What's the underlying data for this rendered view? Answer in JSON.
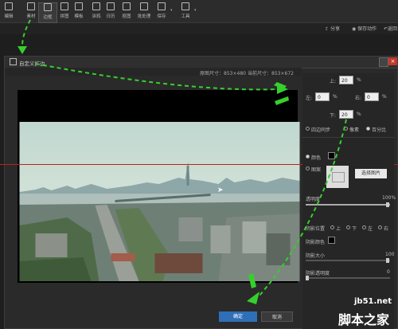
{
  "toolbar": {
    "items": [
      {
        "label": "编辑",
        "icon": "edit-icon"
      },
      {
        "label": "素材",
        "icon": "material-icon"
      },
      {
        "label": "边框",
        "icon": "border-icon"
      },
      {
        "label": "拼图",
        "icon": "collage-icon"
      },
      {
        "label": "模板",
        "icon": "template-icon"
      },
      {
        "label": "涂鸦",
        "icon": "doodle-icon"
      },
      {
        "label": "日历",
        "icon": "calendar-icon"
      },
      {
        "label": "抠图",
        "icon": "cutout-icon"
      },
      {
        "label": "批处理",
        "icon": "batch-icon"
      },
      {
        "label": "保存",
        "icon": "save-icon"
      },
      {
        "label": "工具",
        "icon": "tools-icon"
      }
    ]
  },
  "subbar": {
    "share": "分享",
    "save_action": "保存动作",
    "back": "返回"
  },
  "dialog": {
    "title": "自定义扩边",
    "original_size_label": "原图尺寸：",
    "original_size": "853×480",
    "current_size_label": "当前尺寸：",
    "current_size": "853×672"
  },
  "panel": {
    "top_label": "上:",
    "top_value": "20",
    "left_label": "左:",
    "left_value": "0",
    "right_label": "右:",
    "right_value": "0",
    "bottom_label": "下:",
    "bottom_value": "20",
    "unit": "%",
    "sync_label": "四边同步",
    "pixel_label": "像素",
    "percent_label": "百分比",
    "color_label": "颜色",
    "image_label": "图案",
    "select_image_button": "选择图片",
    "opacity_label": "透明度",
    "opacity_value": "100%",
    "shadow_position_label": "阴影位置",
    "shadow_up": "上",
    "shadow_down": "下",
    "shadow_left": "左",
    "shadow_right": "右",
    "shadow_color_label": "阴影颜色",
    "shadow_size_label": "阴影大小",
    "shadow_size_value": "100",
    "shadow_opacity_label": "阴影透明度",
    "shadow_opacity_value": "0"
  },
  "buttons": {
    "ok": "确定",
    "cancel": "取消"
  },
  "watermark": {
    "site": "jb51.net",
    "name": "脚本之家"
  },
  "colors": {
    "accent_blue": "#2f6fb8",
    "arrow_green": "#35d02c",
    "guide_red": "#c0201c"
  }
}
